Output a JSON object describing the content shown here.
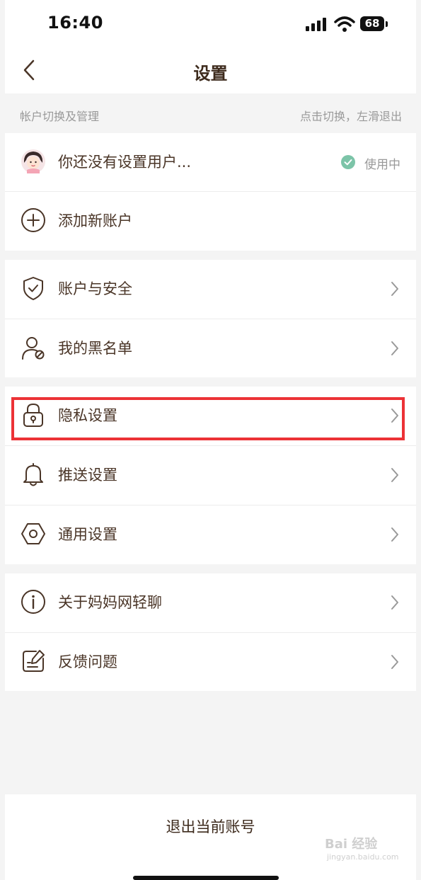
{
  "status_bar": {
    "time": "16:40",
    "battery": "68"
  },
  "nav": {
    "title": "设置"
  },
  "accounts_section": {
    "header_left": "帐户切换及管理",
    "header_right": "点击切换，左滑退出"
  },
  "accounts": {
    "current_user_name": "你还没有设置用户...",
    "current_user_status": "使用中",
    "add_account_label": "添加新账户"
  },
  "group2": [
    {
      "label": "账户与安全",
      "icon": "shield-check-icon"
    },
    {
      "label": "我的黑名单",
      "icon": "user-blocked-icon"
    }
  ],
  "group3": [
    {
      "label": "隐私设置",
      "icon": "lock-icon"
    },
    {
      "label": "推送设置",
      "icon": "bell-icon"
    },
    {
      "label": "通用设置",
      "icon": "hexagon-settings-icon"
    }
  ],
  "group4": [
    {
      "label": "关于妈妈网轻聊",
      "icon": "info-icon"
    },
    {
      "label": "反馈问题",
      "icon": "feedback-icon"
    }
  ],
  "logout_label": "退出当前账号",
  "watermark": {
    "text": "Bai 经验",
    "sub": "jingyan.baidu.com"
  },
  "colors": {
    "highlight": "#ec3236",
    "check": "#7cc4a8",
    "text": "#4a3527"
  }
}
